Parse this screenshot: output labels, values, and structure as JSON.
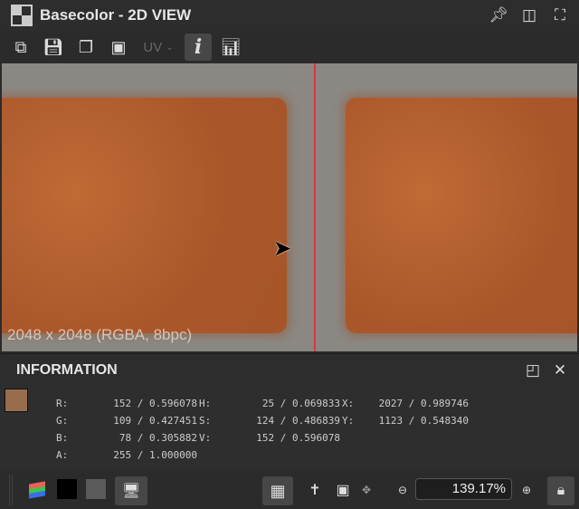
{
  "window": {
    "title": "Basecolor - 2D VIEW"
  },
  "toolbar": {
    "uv_label": "UV"
  },
  "viewport": {
    "dimensions": "2048 x 2048 (RGBA, 8bpc)"
  },
  "info": {
    "title": "INFORMATION",
    "swatch_color": "#986d4e",
    "rgba": [
      {
        "label": "R:",
        "value": "152 / 0.596078"
      },
      {
        "label": "G:",
        "value": "109 / 0.427451"
      },
      {
        "label": "B:",
        "value": "78 / 0.305882"
      },
      {
        "label": "A:",
        "value": "255 / 1.000000"
      }
    ],
    "hsv": [
      {
        "label": "H:",
        "value": "25 / 0.069833"
      },
      {
        "label": "S:",
        "value": "124 / 0.486839"
      },
      {
        "label": "V:",
        "value": "152 / 0.596078"
      }
    ],
    "xy": [
      {
        "label": "X:",
        "value": "2027 / 0.989746"
      },
      {
        "label": "Y:",
        "value": "1123 / 0.548340"
      }
    ]
  },
  "bottom": {
    "zoom": "139.17%"
  }
}
